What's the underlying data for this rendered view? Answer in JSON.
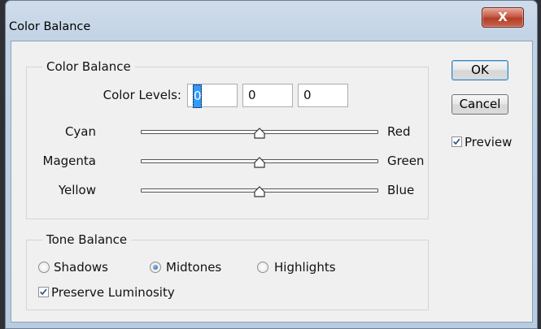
{
  "window": {
    "title": "Color Balance",
    "close_glyph": "X"
  },
  "color_balance": {
    "legend": "Color Balance",
    "levels_label": "Color Levels:",
    "levels": [
      "0",
      "0",
      "0"
    ],
    "sliders": [
      {
        "left": "Cyan",
        "right": "Red",
        "value": 0
      },
      {
        "left": "Magenta",
        "right": "Green",
        "value": 0
      },
      {
        "left": "Yellow",
        "right": "Blue",
        "value": 0
      }
    ]
  },
  "tone_balance": {
    "legend": "Tone Balance",
    "options": [
      "Shadows",
      "Midtones",
      "Highlights"
    ],
    "selected": "Midtones",
    "preserve_luminosity": {
      "label": "Preserve Luminosity",
      "checked": true
    }
  },
  "buttons": {
    "ok": "OK",
    "cancel": "Cancel"
  },
  "preview": {
    "label": "Preview",
    "checked": true
  }
}
